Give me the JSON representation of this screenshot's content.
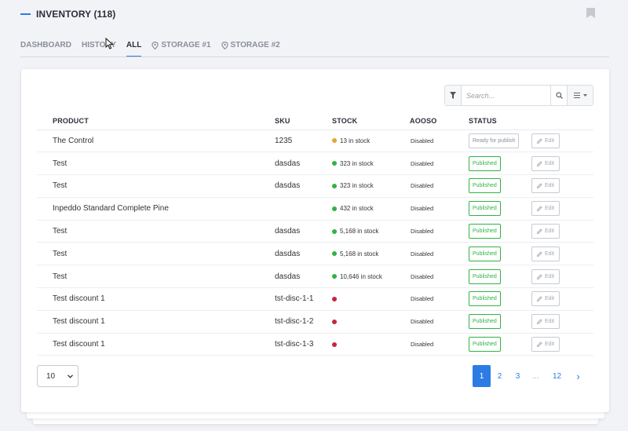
{
  "header": {
    "title": "INVENTORY (118)"
  },
  "tabs": [
    {
      "label": "DASHBOARD",
      "icon": "",
      "active": false
    },
    {
      "label": "HISTORY",
      "icon": "",
      "active": false
    },
    {
      "label": "ALL",
      "icon": "",
      "active": true
    },
    {
      "label": "STORAGE #1",
      "icon": "pin-icon",
      "active": false
    },
    {
      "label": "STORAGE #2",
      "icon": "pin-icon",
      "active": false
    }
  ],
  "toolbar": {
    "search_placeholder": "Search...",
    "search_value": ""
  },
  "table": {
    "columns": [
      "PRODUCT",
      "SKU",
      "STOCK",
      "AOOSO",
      "STATUS"
    ],
    "rows": [
      {
        "product": "The Control",
        "sku": "1235",
        "stock": "13 in stock",
        "stock_color": "#e8a33b",
        "aooso": "Disabled",
        "status": "Ready for publish",
        "status_type": "ready",
        "action": "Edit"
      },
      {
        "product": "Test",
        "sku": "dasdas",
        "stock": "323 in stock",
        "stock_color": "#2fb344",
        "aooso": "Disabled",
        "status": "Published",
        "status_type": "pub",
        "action": "Edit"
      },
      {
        "product": "Test",
        "sku": "dasdas",
        "stock": "323 in stock",
        "stock_color": "#2fb344",
        "aooso": "Disabled",
        "status": "Published",
        "status_type": "pub",
        "action": "Edit"
      },
      {
        "product": "Inpeddo Standard Complete Pine",
        "sku": "",
        "stock": "432 in stock",
        "stock_color": "#2fb344",
        "aooso": "Disabled",
        "status": "Published",
        "status_type": "pub",
        "action": "Edit"
      },
      {
        "product": "Test",
        "sku": "dasdas",
        "stock": "5,168 in stock",
        "stock_color": "#2fb344",
        "aooso": "Disabled",
        "status": "Published",
        "status_type": "pub",
        "action": "Edit"
      },
      {
        "product": "Test",
        "sku": "dasdas",
        "stock": "5,168 in stock",
        "stock_color": "#2fb344",
        "aooso": "Disabled",
        "status": "Published",
        "status_type": "pub",
        "action": "Edit"
      },
      {
        "product": "Test",
        "sku": "dasdas",
        "stock": "10,646 in stock",
        "stock_color": "#2fb344",
        "aooso": "Disabled",
        "status": "Published",
        "status_type": "pub",
        "action": "Edit"
      },
      {
        "product": "Test discount 1",
        "sku": "tst-disc-1-1",
        "stock": "",
        "stock_color": "#c0283e",
        "aooso": "Disabled",
        "status": "Published",
        "status_type": "pub",
        "action": "Edit"
      },
      {
        "product": "Test discount 1",
        "sku": "tst-disc-1-2",
        "stock": "",
        "stock_color": "#c0283e",
        "aooso": "Disabled",
        "status": "Published",
        "status_type": "pub",
        "action": "Edit"
      },
      {
        "product": "Test discount 1",
        "sku": "tst-disc-1-3",
        "stock": "",
        "stock_color": "#c0283e",
        "aooso": "Disabled",
        "status": "Published",
        "status_type": "pub",
        "action": "Edit"
      }
    ]
  },
  "footer": {
    "per_page": "10",
    "pages": [
      "1",
      "2",
      "3",
      "...",
      "12"
    ],
    "current_page": "1",
    "next_label": "›"
  },
  "colors": {
    "accent": "#2d7be5",
    "published": "#2fb344",
    "warning": "#e8a33b",
    "danger": "#c0283e"
  }
}
